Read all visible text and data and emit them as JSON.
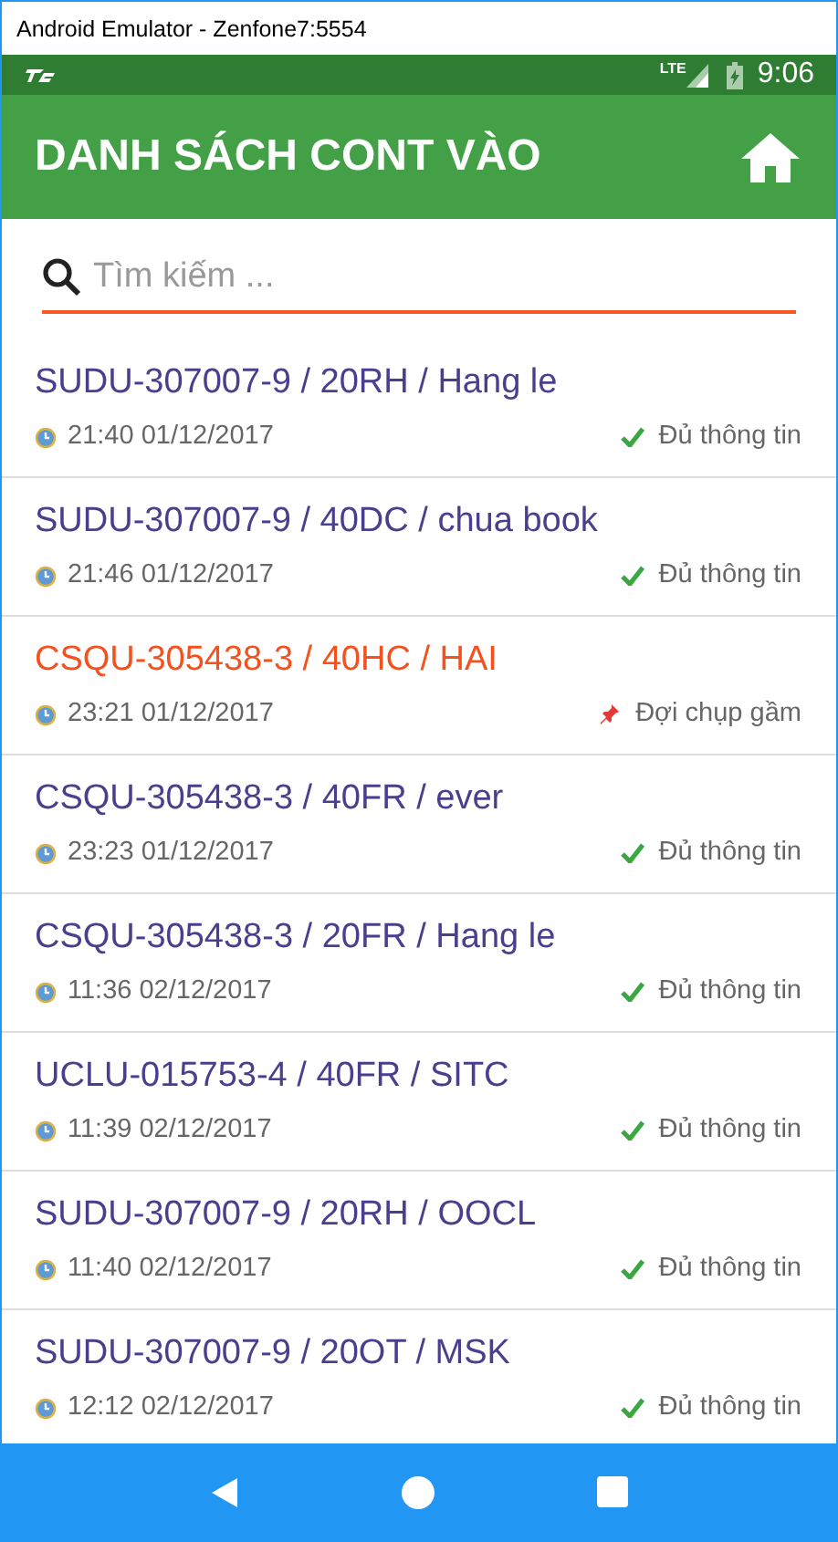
{
  "window": {
    "title": "Android Emulator - Zenfone7:5554"
  },
  "status_bar": {
    "network": "LTE",
    "time": "9:06"
  },
  "app_bar": {
    "title": "DANH SÁCH CONT VÀO"
  },
  "search": {
    "placeholder": "Tìm kiếm ..."
  },
  "items": [
    {
      "title": "SUDU-307007-9 / 20RH / Hang le",
      "time": "21:40 01/12/2017",
      "kind": "done",
      "status": "Đủ thông tin"
    },
    {
      "title": "SUDU-307007-9 / 40DC / chua book",
      "time": "21:46 01/12/2017",
      "kind": "done",
      "status": "Đủ thông tin"
    },
    {
      "title": "CSQU-305438-3 / 40HC / HAI",
      "time": "23:21 01/12/2017",
      "kind": "pending",
      "status": "Đợi chụp gầm"
    },
    {
      "title": "CSQU-305438-3 / 40FR / ever",
      "time": "23:23 01/12/2017",
      "kind": "done",
      "status": "Đủ thông tin"
    },
    {
      "title": "CSQU-305438-3 / 20FR / Hang le",
      "time": "11:36 02/12/2017",
      "kind": "done",
      "status": "Đủ thông tin"
    },
    {
      "title": "UCLU-015753-4 / 40FR / SITC",
      "time": "11:39 02/12/2017",
      "kind": "done",
      "status": "Đủ thông tin"
    },
    {
      "title": "SUDU-307007-9 / 20RH / OOCL",
      "time": "11:40 02/12/2017",
      "kind": "done",
      "status": "Đủ thông tin"
    },
    {
      "title": "SUDU-307007-9 / 20OT / MSK",
      "time": "12:12 02/12/2017",
      "kind": "done",
      "status": "Đủ thông tin"
    }
  ]
}
